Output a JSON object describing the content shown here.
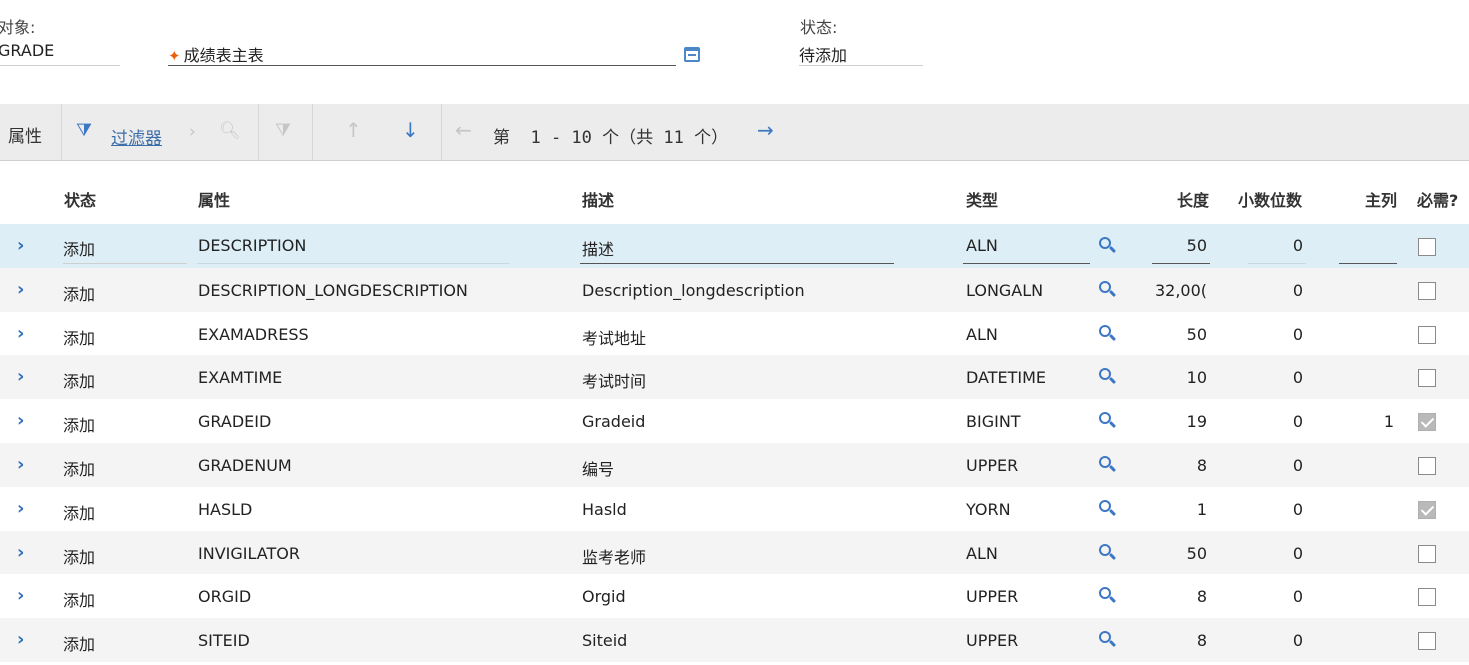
{
  "header": {
    "object_label": "对象:",
    "object_value": "GRADE",
    "description_value": "成绩表主表",
    "required_mark": "✦",
    "status_label": "状态:",
    "status_value": "待添加"
  },
  "toolbar": {
    "title": "属性",
    "filter_label": "过滤器",
    "page_prefix": "第",
    "page_range": "1 - 10",
    "page_suffix": "个（共",
    "page_total": "11",
    "page_end": "个）"
  },
  "table": {
    "columns": {
      "status": "状态",
      "attribute": "属性",
      "description": "描述",
      "type": "类型",
      "length": "长度",
      "scale": "小数位数",
      "primary": "主列",
      "required": "必需?"
    },
    "rows": [
      {
        "status": "添加",
        "attribute": "DESCRIPTION",
        "description": "描述",
        "type": "ALN",
        "length": "50",
        "scale": "0",
        "primary": "",
        "required": false
      },
      {
        "status": "添加",
        "attribute": "DESCRIPTION_LONGDESCRIPTION",
        "description": "Description_longdescription",
        "type": "LONGALN",
        "length": "32,00(",
        "scale": "0",
        "primary": "",
        "required": false
      },
      {
        "status": "添加",
        "attribute": "EXAMADRESS",
        "description": "考试地址",
        "type": "ALN",
        "length": "50",
        "scale": "0",
        "primary": "",
        "required": false
      },
      {
        "status": "添加",
        "attribute": "EXAMTIME",
        "description": "考试时间",
        "type": "DATETIME",
        "length": "10",
        "scale": "0",
        "primary": "",
        "required": false
      },
      {
        "status": "添加",
        "attribute": "GRADEID",
        "description": "Gradeid",
        "type": "BIGINT",
        "length": "19",
        "scale": "0",
        "primary": "1",
        "required": true
      },
      {
        "status": "添加",
        "attribute": "GRADENUM",
        "description": "编号",
        "type": "UPPER",
        "length": "8",
        "scale": "0",
        "primary": "",
        "required": false
      },
      {
        "status": "添加",
        "attribute": "HASLD",
        "description": "Hasld",
        "type": "YORN",
        "length": "1",
        "scale": "0",
        "primary": "",
        "required": true
      },
      {
        "status": "添加",
        "attribute": "INVIGILATOR",
        "description": "监考老师",
        "type": "ALN",
        "length": "50",
        "scale": "0",
        "primary": "",
        "required": false
      },
      {
        "status": "添加",
        "attribute": "ORGID",
        "description": "Orgid",
        "type": "UPPER",
        "length": "8",
        "scale": "0",
        "primary": "",
        "required": false
      },
      {
        "status": "添加",
        "attribute": "SITEID",
        "description": "Siteid",
        "type": "UPPER",
        "length": "8",
        "scale": "0",
        "primary": "",
        "required": false
      }
    ]
  },
  "colors": {
    "accent": "#3c77c4",
    "selected_row": "#ddeef6",
    "alt_row": "#f4f4f4",
    "toolbar_bg": "#ececec",
    "required_mark": "#e8620d"
  },
  "icons": {
    "filter": "filter-icon",
    "search": "search-icon",
    "clear_filter": "clear-filter-icon",
    "move_up": "arrow-up-icon",
    "move_down": "arrow-down-icon",
    "prev_page": "arrow-left-icon",
    "next_page": "arrow-right-icon",
    "row_expand": "chevron-right-icon",
    "lookup": "magnifier-icon",
    "calendar": "calendar-icon"
  }
}
